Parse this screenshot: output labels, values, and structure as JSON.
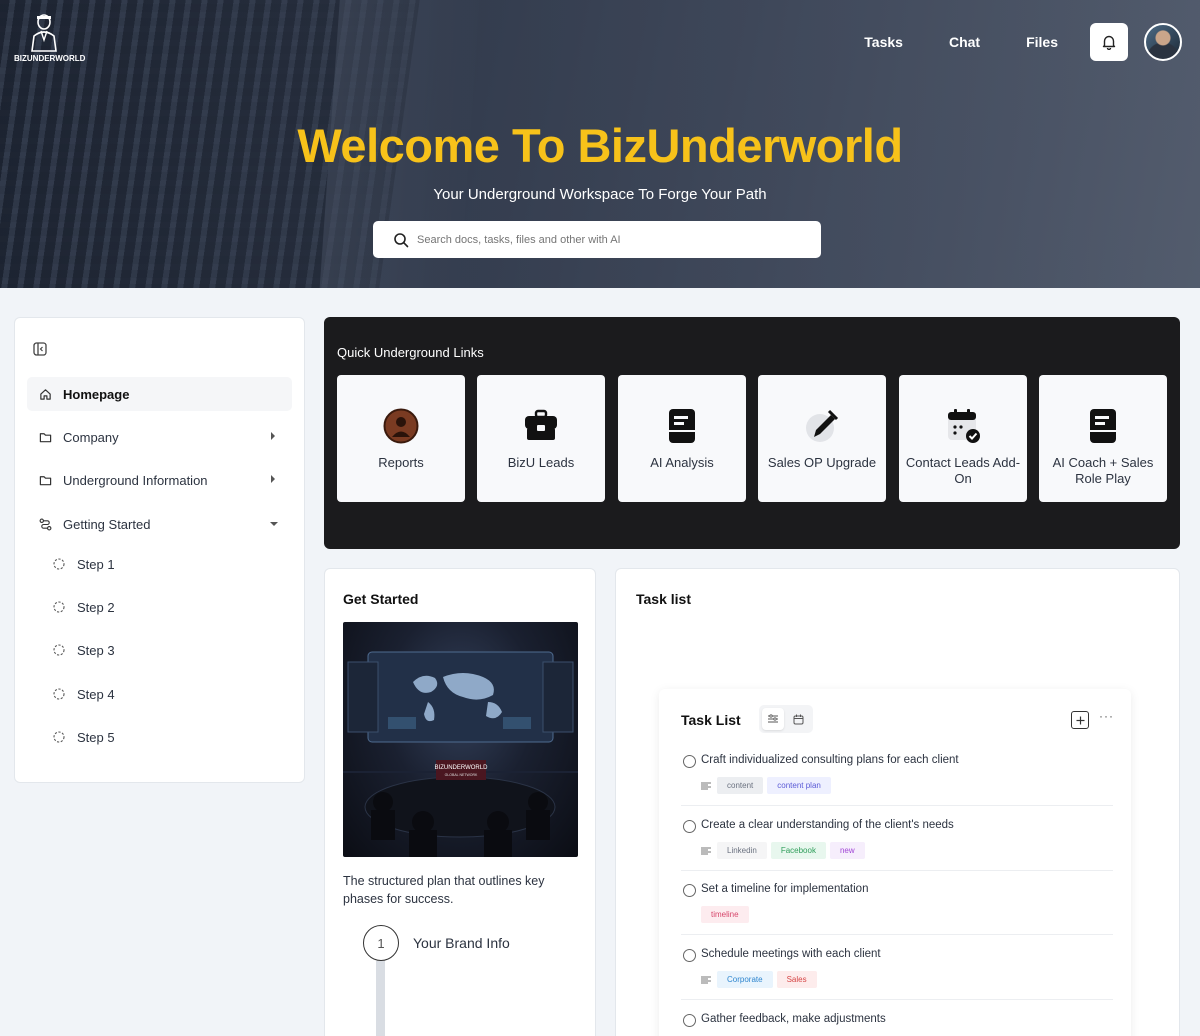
{
  "brand": {
    "logo_text": "BIZUNDERWORLD"
  },
  "nav": {
    "tasks": "Tasks",
    "chat": "Chat",
    "files": "Files"
  },
  "hero": {
    "title": "Welcome To BizUnderworld",
    "subtitle": "Your Underground Workspace To Forge Your Path",
    "search_placeholder": "Search docs, tasks, files and other with AI"
  },
  "sidebar": {
    "items": [
      {
        "label": "Homepage",
        "icon": "home-icon",
        "active": true
      },
      {
        "label": "Company",
        "icon": "folder-icon",
        "expandable": true
      },
      {
        "label": "Underground Information",
        "icon": "folder-icon",
        "expandable": true
      },
      {
        "label": "Getting Started",
        "icon": "route-icon",
        "expanded": true
      }
    ],
    "steps": [
      "Step 1",
      "Step 2",
      "Step 3",
      "Step 4",
      "Step 5"
    ]
  },
  "quick_links": {
    "title": "Quick Underground Links",
    "cards": [
      {
        "label": "Reports",
        "icon": "reports-avatar-icon"
      },
      {
        "label": "BizU Leads",
        "icon": "briefcase-icon"
      },
      {
        "label": "AI Analysis",
        "icon": "document-icon"
      },
      {
        "label": "Sales OP Upgrade",
        "icon": "pencil-icon"
      },
      {
        "label": "Contact Leads Add-On",
        "icon": "calendar-check-icon"
      },
      {
        "label": "AI Coach + Sales Role Play",
        "icon": "document-icon"
      }
    ]
  },
  "get_started": {
    "title": "Get Started",
    "image_caption": "BIZUNDERWORLD",
    "image_subcaption": "GLOBAL NETWORK",
    "description": "The structured plan that outlines key phases for success.",
    "step_number": "1",
    "step_label": "Your Brand Info"
  },
  "task_list": {
    "card_title": "Task list",
    "inner_title": "Task List",
    "tasks": [
      {
        "text": "Craft individualized consulting plans for each client",
        "tags": [
          {
            "label": "content",
            "bg": "#eceef1",
            "fg": "#6b7280"
          },
          {
            "label": "content plan",
            "bg": "#eef0ff",
            "fg": "#5b5bd6"
          }
        ]
      },
      {
        "text": "Create a clear understanding of the client's needs",
        "tags": [
          {
            "label": "Linkedin",
            "bg": "#f5f5f6",
            "fg": "#6b7280"
          },
          {
            "label": "Facebook",
            "bg": "#e8f7ee",
            "fg": "#2f9e5a"
          },
          {
            "label": "new",
            "bg": "#f6eefc",
            "fg": "#a146d6"
          }
        ]
      },
      {
        "text": "Set a timeline for implementation",
        "tags": [
          {
            "label": "timeline",
            "bg": "#fdecef",
            "fg": "#d6456a"
          }
        ]
      },
      {
        "text": "Schedule meetings with each client",
        "tags": [
          {
            "label": "Corporate",
            "bg": "#e9f4fd",
            "fg": "#2f86cf"
          },
          {
            "label": "Sales",
            "bg": "#fdecec",
            "fg": "#d64545"
          }
        ]
      },
      {
        "text": "Gather feedback, make adjustments",
        "tags": []
      }
    ]
  }
}
